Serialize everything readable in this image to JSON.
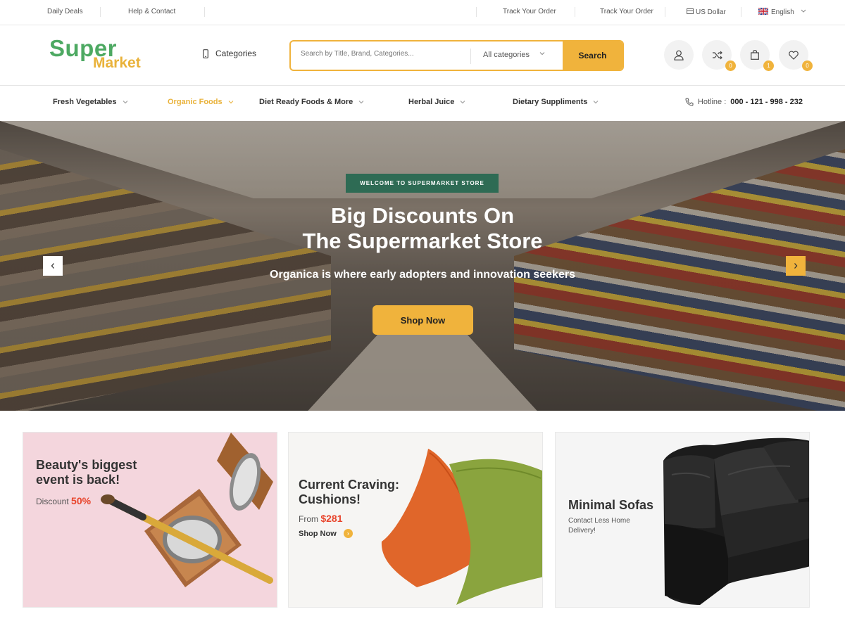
{
  "topbar": {
    "daily_deals": "Daily Deals",
    "help_contact": "Help & Contact",
    "track_order_1": "Track Your Order",
    "track_order_2": "Track Your Order",
    "currency": "US Dollar",
    "language": "English"
  },
  "header": {
    "logo_line1": "Super",
    "logo_line2": "Market",
    "categories_label": "Categories",
    "search_placeholder": "Search by Title, Brand, Categories...",
    "search_category": "All categories",
    "search_button": "Search",
    "badges": {
      "compare": "0",
      "cart": "1",
      "wishlist": "0"
    }
  },
  "nav": {
    "items": [
      {
        "label": "Fresh Vegetables"
      },
      {
        "label": "Organic Foods"
      },
      {
        "label": "Diet Ready Foods & More"
      },
      {
        "label": "Herbal Juice"
      },
      {
        "label": "Dietary Suppliments"
      }
    ],
    "active_index": 1,
    "hotline_label": "Hotline :",
    "hotline_number": "000 - 121 - 998 - 232"
  },
  "hero": {
    "welcome": "WELCOME TO SUPERMARKET STORE",
    "title_line1": "Big Discounts On",
    "title_line2": "The Supermarket Store",
    "subtitle": "Organica is where early adopters and innovation seekers",
    "button": "Shop Now"
  },
  "promos": [
    {
      "title_line1": "Beauty's biggest",
      "title_line2": "event is back!",
      "sub_label": "Discount",
      "sub_value": "50%"
    },
    {
      "title_line1": "Current Craving:",
      "title_line2": "Cushions!",
      "sub_label": "From",
      "sub_value": "$281",
      "link": "Shop Now"
    },
    {
      "title_line1": "Minimal Sofas",
      "desc_line1": "Contact Less Home",
      "desc_line2": "Delivery!"
    }
  ],
  "colors": {
    "accent": "#f0b33c",
    "brand_green": "#4da962",
    "welcome_bg": "#2e6b54",
    "price_red": "#e8452c"
  },
  "icons": [
    "phone-icon",
    "chevron-down-icon",
    "user-icon",
    "shuffle-icon",
    "bag-icon",
    "heart-icon",
    "flag-icon",
    "wallet-icon",
    "chevron-left-icon",
    "chevron-right-icon"
  ]
}
